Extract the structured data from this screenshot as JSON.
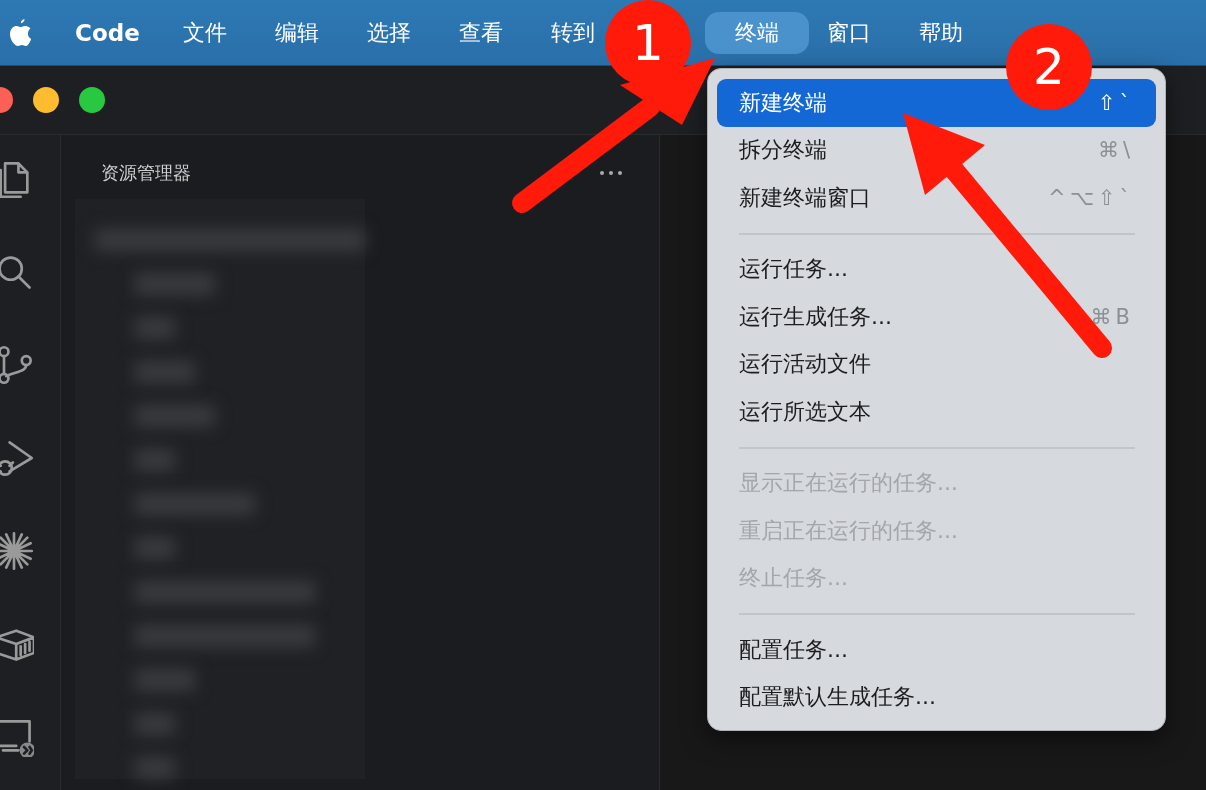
{
  "menubar": {
    "app_name": "Code",
    "items": [
      {
        "label": "文件",
        "selected": false
      },
      {
        "label": "编辑",
        "selected": false
      },
      {
        "label": "选择",
        "selected": false
      },
      {
        "label": "查看",
        "selected": false
      },
      {
        "label": "转到",
        "selected": false
      },
      {
        "label": "终端",
        "selected": true
      },
      {
        "label": "窗口",
        "selected": false
      },
      {
        "label": "帮助",
        "selected": false
      }
    ]
  },
  "sidebar": {
    "title": "资源管理器"
  },
  "terminal_menu": {
    "items": [
      {
        "kind": "item",
        "label": "新建终端",
        "shortcut": "⇧`",
        "selected": true,
        "disabled": false
      },
      {
        "kind": "item",
        "label": "拆分终端",
        "shortcut": "⌘\\",
        "selected": false,
        "disabled": false
      },
      {
        "kind": "item",
        "label": "新建终端窗口",
        "shortcut": "^⌥⇧`",
        "selected": false,
        "disabled": false
      },
      {
        "kind": "separator"
      },
      {
        "kind": "item",
        "label": "运行任务...",
        "selected": false,
        "disabled": false
      },
      {
        "kind": "item",
        "label": "运行生成任务...",
        "shortcut": "⌘B",
        "selected": false,
        "disabled": false
      },
      {
        "kind": "item",
        "label": "运行活动文件",
        "selected": false,
        "disabled": false
      },
      {
        "kind": "item",
        "label": "运行所选文本",
        "selected": false,
        "disabled": false
      },
      {
        "kind": "separator"
      },
      {
        "kind": "item",
        "label": "显示正在运行的任务...",
        "selected": false,
        "disabled": true
      },
      {
        "kind": "item",
        "label": "重启正在运行的任务...",
        "selected": false,
        "disabled": true
      },
      {
        "kind": "item",
        "label": "终止任务...",
        "selected": false,
        "disabled": true
      },
      {
        "kind": "separator"
      },
      {
        "kind": "item",
        "label": "配置任务...",
        "selected": false,
        "disabled": false
      },
      {
        "kind": "item",
        "label": "配置默认生成任务...",
        "selected": false,
        "disabled": false
      }
    ]
  },
  "annotations": [
    {
      "label": "1"
    },
    {
      "label": "2"
    }
  ]
}
